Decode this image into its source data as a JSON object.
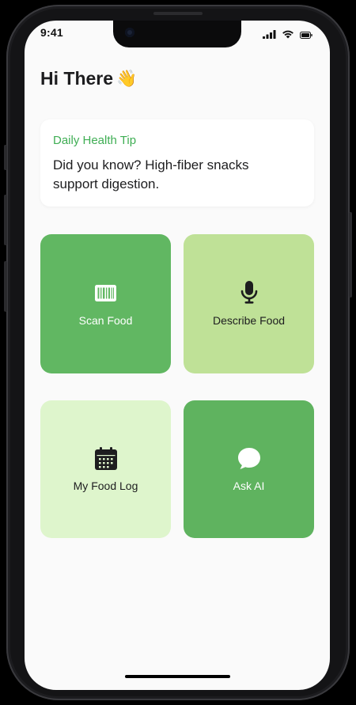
{
  "status_bar": {
    "time": "9:41",
    "icons": [
      "cellular-signal-icon",
      "wifi-icon",
      "battery-icon"
    ]
  },
  "greeting": {
    "text": "Hi There",
    "emoji": "👋"
  },
  "tip_card": {
    "title": "Daily Health Tip",
    "body": "Did you know? High-fiber snacks support digestion."
  },
  "tiles": [
    {
      "label": "Scan Food",
      "icon": "barcode-icon",
      "bg": "#61b762",
      "fg": "#ffffff"
    },
    {
      "label": "Describe Food",
      "icon": "microphone-icon",
      "bg": "#bfe197",
      "fg": "#1d1d1f"
    },
    {
      "label": "My Food Log",
      "icon": "calendar-icon",
      "bg": "#def5cc",
      "fg": "#1d1d1f"
    },
    {
      "label": "Ask AI",
      "icon": "chat-bubble-icon",
      "bg": "#5fb35f",
      "fg": "#ffffff"
    }
  ],
  "colors": {
    "accent": "#3fae54",
    "screen_bg": "#fafafa",
    "text": "#1d1d1f"
  }
}
